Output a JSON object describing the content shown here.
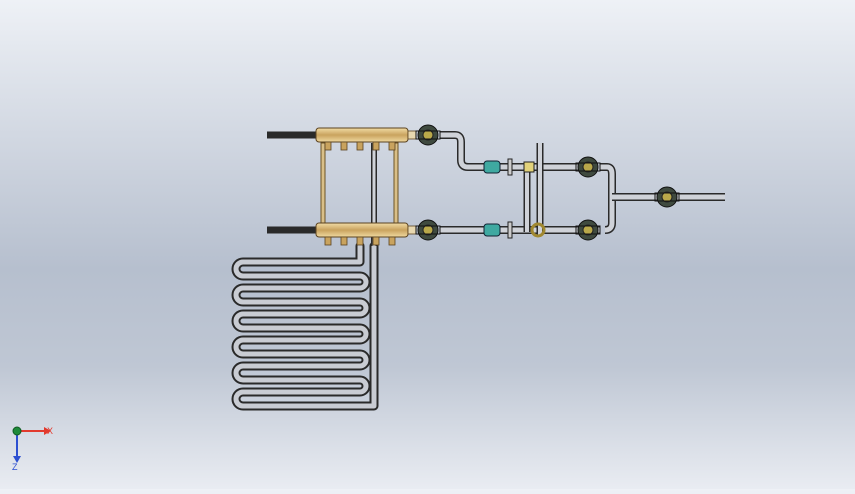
{
  "triad": {
    "x_label": "X",
    "z_label": "Z",
    "colors": {
      "x": "#e23a2e",
      "z": "#2c4fd1",
      "origin": "#1f8a3a"
    }
  },
  "model": {
    "colors": {
      "pipe_fill": "#c9ccd3",
      "pipe_edge": "#2a2a2a",
      "brass": "#d9b877",
      "brass_dark": "#a07b3a",
      "valve_body": "#4a5a4a",
      "valve_accent": "#b9a84a",
      "fitting_teal": "#3fa9a1",
      "fitting_yellow": "#e2d27a"
    }
  }
}
